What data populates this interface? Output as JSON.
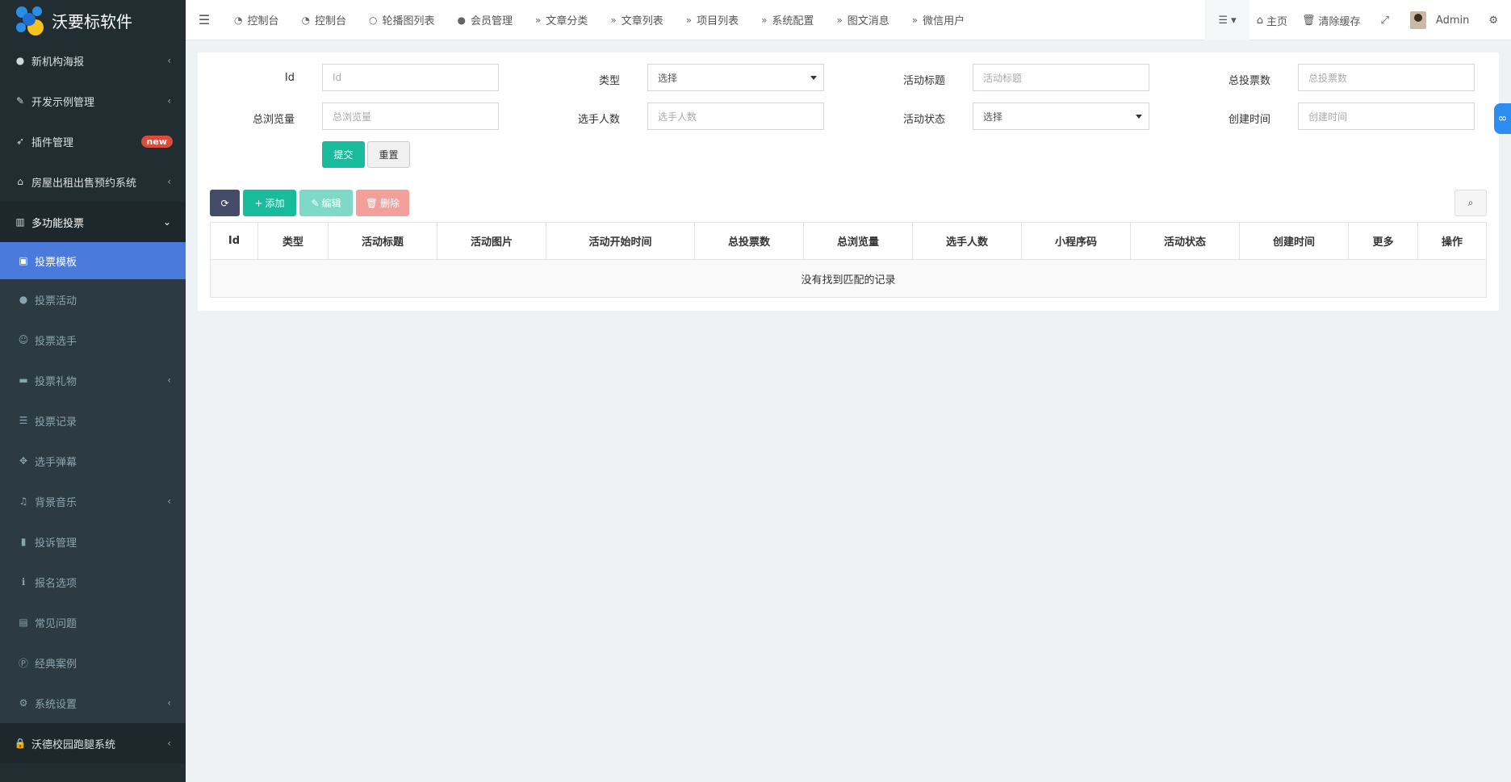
{
  "app": {
    "title": "沃要标软件"
  },
  "sidebar": {
    "items": [
      {
        "label": "新机构海报",
        "icon": "globe-icon"
      },
      {
        "label": "开发示例管理",
        "icon": "magic-icon"
      },
      {
        "label": "插件管理",
        "icon": "rocket-icon",
        "badge": "new"
      },
      {
        "label": "房屋出租出售预约系统",
        "icon": "home-icon"
      },
      {
        "label": "多功能投票",
        "icon": "columns-icon"
      }
    ],
    "sub_items": [
      {
        "label": "投票模板",
        "icon": "image-icon"
      },
      {
        "label": "投票活动",
        "icon": "bomb-icon"
      },
      {
        "label": "投票选手",
        "icon": "user-plus-icon"
      },
      {
        "label": "投票礼物",
        "icon": "archive-icon"
      },
      {
        "label": "投票记录",
        "icon": "list-icon"
      },
      {
        "label": "选手弹幕",
        "icon": "arrows-icon"
      },
      {
        "label": "背景音乐",
        "icon": "music-icon"
      },
      {
        "label": "投诉管理",
        "icon": "bookmark-icon"
      },
      {
        "label": "报名选项",
        "icon": "info-icon"
      },
      {
        "label": "常见问题",
        "icon": "file-word-icon"
      },
      {
        "label": "经典案例",
        "icon": "product-hunt-icon"
      },
      {
        "label": "系统设置",
        "icon": "gear-icon"
      }
    ],
    "bottom_item": {
      "label": "沃德校园跑腿系统",
      "icon": "lock-icon"
    }
  },
  "topbar": {
    "tabs": [
      {
        "label": "控制台",
        "icon": "dashboard-icon"
      },
      {
        "label": "控制台",
        "icon": "dashboard-icon"
      },
      {
        "label": "轮播图列表",
        "icon": "circle-icon"
      },
      {
        "label": "会员管理",
        "icon": "user-icon"
      },
      {
        "label": "文章分类",
        "icon": "double-chevron-icon"
      },
      {
        "label": "文章列表",
        "icon": "double-chevron-icon"
      },
      {
        "label": "项目列表",
        "icon": "double-chevron-icon"
      },
      {
        "label": "系统配置",
        "icon": "double-chevron-icon"
      },
      {
        "label": "图文消息",
        "icon": "double-chevron-icon"
      },
      {
        "label": "微信用户",
        "icon": "double-chevron-icon"
      }
    ],
    "home_label": "主页",
    "clear_cache_label": "清除缓存",
    "user_name": "Admin"
  },
  "search_form": {
    "fields": [
      {
        "label": "Id",
        "placeholder": "Id",
        "type": "input"
      },
      {
        "label": "类型",
        "value": "选择",
        "type": "select"
      },
      {
        "label": "活动标题",
        "placeholder": "活动标题",
        "type": "input"
      },
      {
        "label": "总投票数",
        "placeholder": "总投票数",
        "type": "input"
      },
      {
        "label": "总浏览量",
        "placeholder": "总浏览量",
        "type": "input"
      },
      {
        "label": "选手人数",
        "placeholder": "选手人数",
        "type": "input"
      },
      {
        "label": "活动状态",
        "value": "选择",
        "type": "select"
      },
      {
        "label": "创建时间",
        "placeholder": "创建时间",
        "type": "input"
      }
    ],
    "submit_label": "提交",
    "reset_label": "重置"
  },
  "toolbar": {
    "add_label": "添加",
    "edit_label": "编辑",
    "delete_label": "删除"
  },
  "table": {
    "columns": [
      "Id",
      "类型",
      "活动标题",
      "活动图片",
      "活动开始时间",
      "总投票数",
      "总浏览量",
      "选手人数",
      "小程序码",
      "活动状态",
      "创建时间",
      "更多",
      "操作"
    ],
    "empty_text": "没有找到匹配的记录"
  },
  "colors": {
    "sidebar_bg": "#222d32",
    "active_item": "#4a7bdc",
    "primary_green": "#18bc9c",
    "danger": "#f08a80",
    "dark_button": "#444c69"
  }
}
